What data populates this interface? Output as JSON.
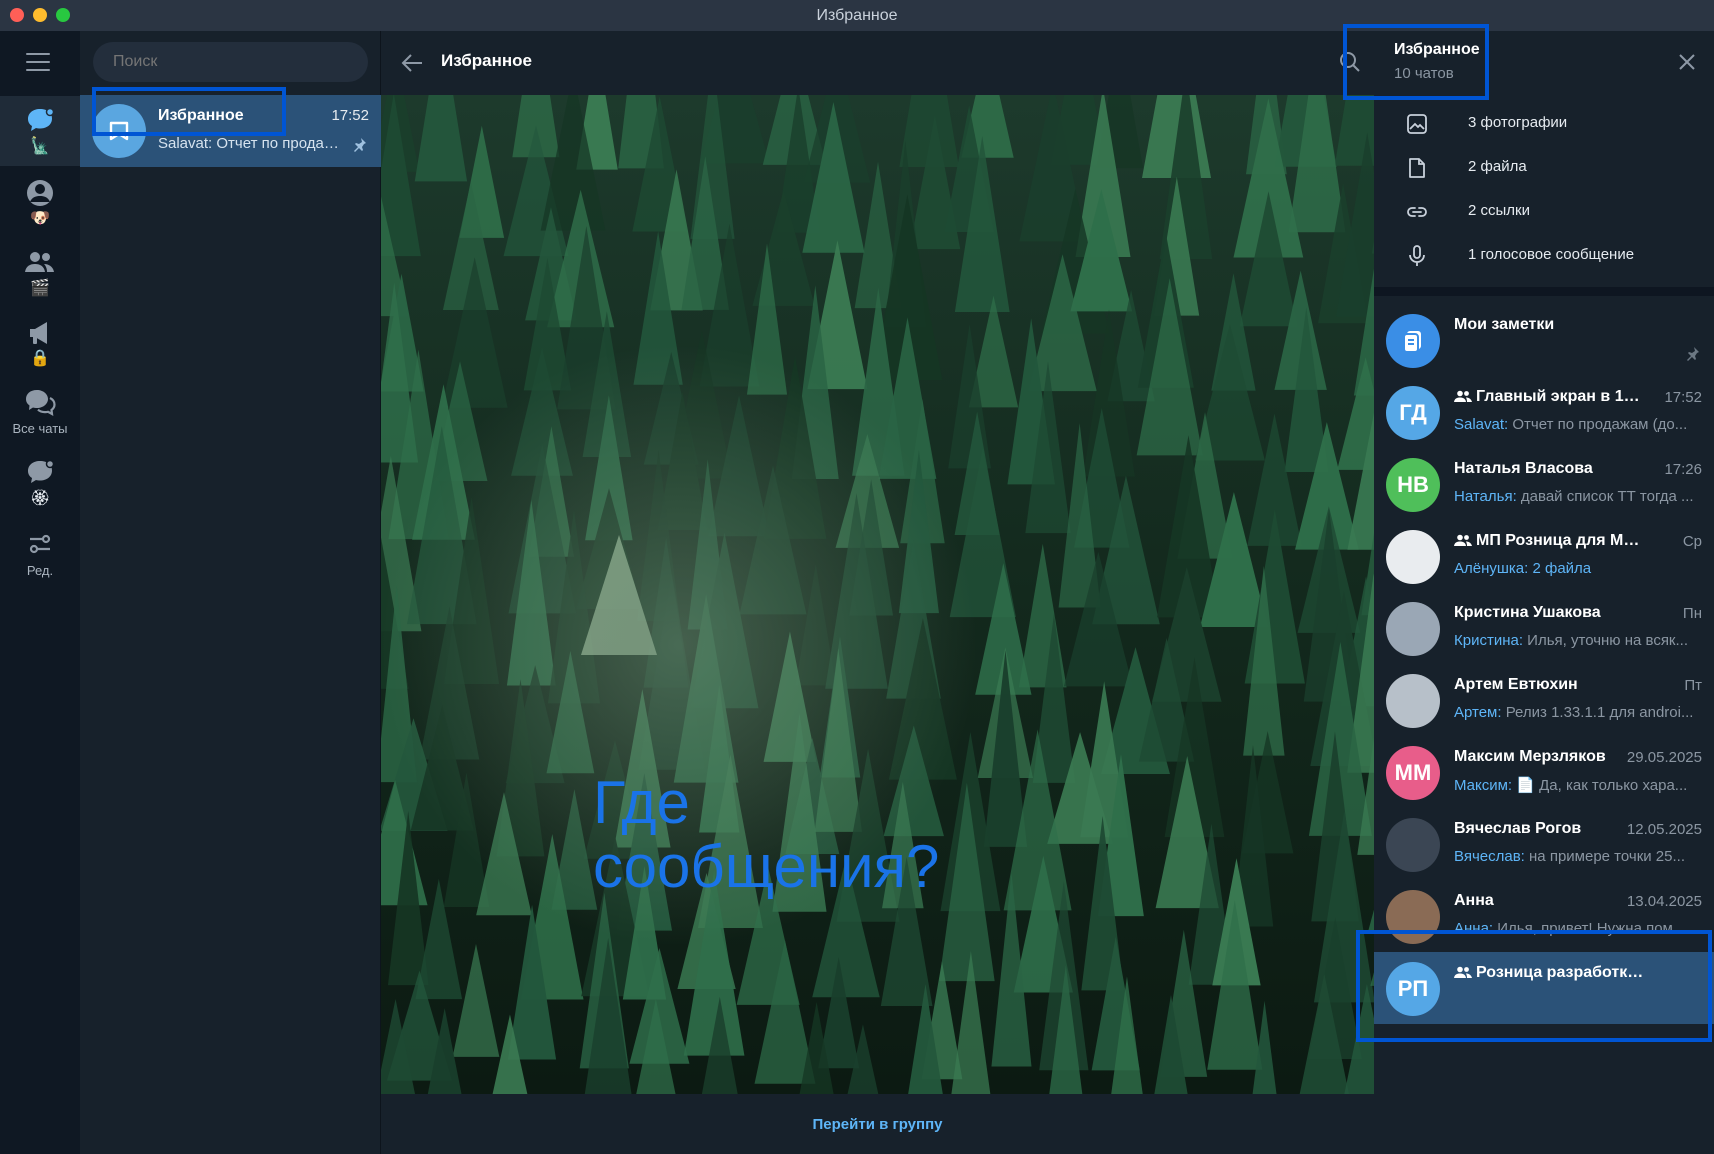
{
  "window": {
    "title": "Избранное"
  },
  "folders": [
    {
      "icon": "chat-bubble-icon",
      "emoji": "🗽",
      "label": ""
    },
    {
      "icon": "user-icon",
      "emoji": "🐶",
      "label": ""
    },
    {
      "icon": "group-icon",
      "emoji": "🎬",
      "label": ""
    },
    {
      "icon": "megaphone-icon",
      "emoji": "🔒",
      "label": ""
    },
    {
      "icon": "chats-icon",
      "emoji": "",
      "label": "Все чаты"
    },
    {
      "icon": "chat-bubble-icon",
      "emoji": "🏵",
      "label": ""
    },
    {
      "icon": "settings-sliders-icon",
      "emoji": "",
      "label": "Ред."
    }
  ],
  "chatlist": {
    "search_placeholder": "Поиск",
    "active": {
      "name": "Избранное",
      "time": "17:52",
      "preview": "Salavat: Отчет по продажам (до..."
    }
  },
  "center": {
    "title": "Избранное",
    "overlay_text_line1": "Где",
    "overlay_text_line2": "сообщения?",
    "footer_link": "Перейти в группу"
  },
  "rpanel": {
    "title": "Избранное",
    "subtitle": "10 чатов",
    "media": [
      {
        "icon": "photo-icon",
        "label": "3 фотографии"
      },
      {
        "icon": "file-icon",
        "label": "2 файла"
      },
      {
        "icon": "link-icon",
        "label": "2 ссылки"
      },
      {
        "icon": "microphone-icon",
        "label": "1 голосовое сообщение"
      }
    ],
    "chats": [
      {
        "name": "Мои заметки",
        "time": "",
        "sender": "",
        "preview": "",
        "initials": "",
        "color": "#3a8ee6",
        "pinned": true,
        "group": false
      },
      {
        "name": "Главный экран в 1С: ...",
        "time": "17:52",
        "sender": "Salavat:",
        "preview": " Отчет по продажам (до...",
        "initials": "ГД",
        "color": "#55a7e6",
        "pinned": false,
        "group": true
      },
      {
        "name": "Наталья Власова",
        "time": "17:26",
        "sender": "Наталья:",
        "preview": " давай список ТТ тогда ...",
        "initials": "НВ",
        "color": "#4fbf5a",
        "pinned": false,
        "group": false
      },
      {
        "name": "МП Розница для Микро...",
        "time": "Ср",
        "sender": "Алёнушка: 2 файла",
        "preview": "",
        "initials": "",
        "color": "#e9ecef",
        "pinned": false,
        "group": true
      },
      {
        "name": "Кристина Ушакова",
        "time": "Пн",
        "sender": "Кристина:",
        "preview": " Илья, уточню на всяк...",
        "initials": "",
        "color": "#9aa7b5",
        "pinned": false,
        "group": false
      },
      {
        "name": "Артем Евтюхин",
        "time": "Пт",
        "sender": "Артем:",
        "preview": " Релиз 1.33.1.1 для androi...",
        "initials": "",
        "color": "#b7c0c9",
        "pinned": false,
        "group": false
      },
      {
        "name": "Максим Мерзляков",
        "time": "29.05.2025",
        "sender": "Максим:",
        "preview": " 📄 Да, как только хара...",
        "initials": "ММ",
        "color": "#e85d8a",
        "pinned": false,
        "group": false
      },
      {
        "name": "Вячеслав Рогов",
        "time": "12.05.2025",
        "sender": "Вячеслав:",
        "preview": " на примере точки 25...",
        "initials": "",
        "color": "#3b4654",
        "pinned": false,
        "group": false
      },
      {
        "name": "Анна",
        "time": "13.04.2025",
        "sender": "Анна:",
        "preview": " Илья, привет! Нужна пом...",
        "initials": "",
        "color": "#8a6b55",
        "pinned": false,
        "group": false
      },
      {
        "name": "Розница разработка + Под...",
        "time": "",
        "sender": "",
        "preview": "",
        "initials": "РП",
        "color": "#55a7e6",
        "pinned": false,
        "group": true
      }
    ]
  }
}
